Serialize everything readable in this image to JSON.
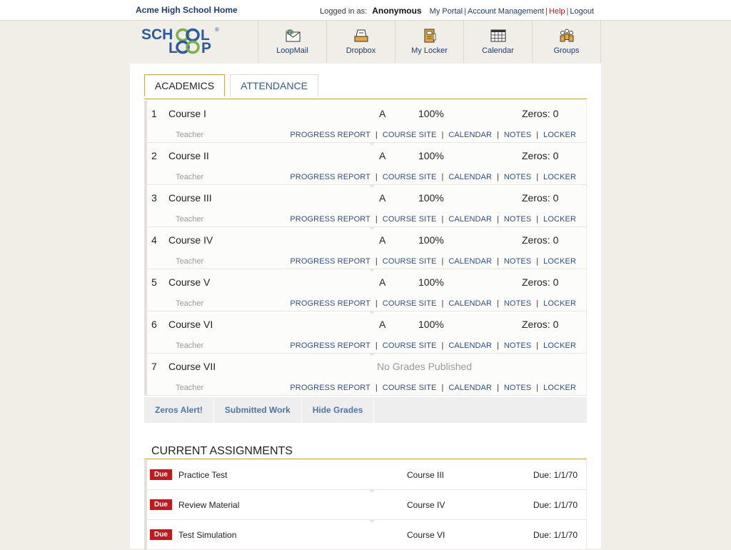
{
  "topbar": {
    "school_home": "Acme High School Home",
    "logged_in_label": "Logged in as:",
    "username": "Anonymous",
    "links": {
      "portal": "My Portal",
      "account": "Account Management",
      "help": "Help",
      "logout": "Logout"
    },
    "separator": "|"
  },
  "logo": {
    "text_top": "SCH",
    "text_bottom": "L",
    "loop_glyphs": "OO",
    "registered": "®"
  },
  "nav": {
    "loopmail": "LoopMail",
    "dropbox": "Dropbox",
    "locker": "My Locker",
    "calendar": "Calendar",
    "groups": "Groups"
  },
  "tabs": {
    "academics": "ACADEMICS",
    "attendance": "ATTENDANCE"
  },
  "link_labels": {
    "progress_report": "PROGRESS REPORT",
    "course_site": "COURSE SITE",
    "calendar": "CALENDAR",
    "notes": "NOTES",
    "locker": "LOCKER",
    "sep": "|"
  },
  "courses": [
    {
      "num": "1",
      "name": "Course I",
      "grade": "A",
      "percent": "100%",
      "zeros": "Zeros: 0",
      "teacher": "Teacher"
    },
    {
      "num": "2",
      "name": "Course II",
      "grade": "A",
      "percent": "100%",
      "zeros": "Zeros: 0",
      "teacher": "Teacher"
    },
    {
      "num": "3",
      "name": "Course III",
      "grade": "A",
      "percent": "100%",
      "zeros": "Zeros: 0",
      "teacher": "Teacher"
    },
    {
      "num": "4",
      "name": "Course IV",
      "grade": "A",
      "percent": "100%",
      "zeros": "Zeros: 0",
      "teacher": "Teacher"
    },
    {
      "num": "5",
      "name": "Course V",
      "grade": "A",
      "percent": "100%",
      "zeros": "Zeros: 0",
      "teacher": "Teacher"
    },
    {
      "num": "6",
      "name": "Course VI",
      "grade": "A",
      "percent": "100%",
      "zeros": "Zeros: 0",
      "teacher": "Teacher"
    },
    {
      "num": "7",
      "name": "Course VII",
      "no_grades": "No Grades Published",
      "teacher": "Teacher"
    }
  ],
  "actions": {
    "zeros_alert": "Zeros Alert!",
    "submitted_work": "Submitted Work",
    "hide_grades": "Hide Grades"
  },
  "assignments_title": "CURRENT ASSIGNMENTS",
  "assignments": [
    {
      "badge": "Due",
      "name": "Practice Test",
      "course": "Course III",
      "due": "Due: 1/1/70"
    },
    {
      "badge": "Due",
      "name": "Review Material",
      "course": "Course IV",
      "due": "Due: 1/1/70"
    },
    {
      "badge": "Due",
      "name": "Test Simulation",
      "course": "Course VI",
      "due": "Due: 1/1/70"
    }
  ],
  "colors": {
    "accent": "#d6a14a",
    "link": "#1f3b73",
    "help": "#c8171a",
    "badge": "#c8171a",
    "logo_blue": "#2b5aa3",
    "logo_green": "#7bb04a"
  }
}
